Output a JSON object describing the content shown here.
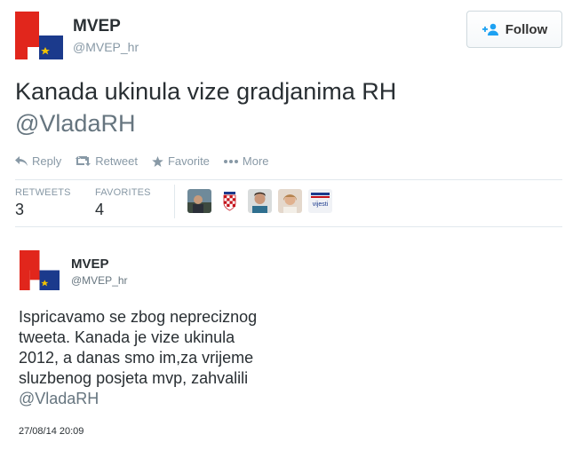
{
  "tweet1": {
    "name": "MVEP",
    "handle": "@MVEP_hr",
    "follow_label": "Follow",
    "text": "Kanada ukinula vize gradjanima RH",
    "mention": "@VladaRH",
    "actions": {
      "reply": "Reply",
      "retweet": "Retweet",
      "favorite": "Favorite",
      "more": "More"
    },
    "stats": {
      "retweets_label": "RETWEETS",
      "retweets_value": "3",
      "favorites_label": "FAVORITES",
      "favorites_value": "4"
    },
    "favorited_by_icons": [
      "user-photo-1",
      "croatia-crest-icon",
      "user-photo-2",
      "user-photo-3",
      "vijesti-logo"
    ],
    "vijesti_logo_text": "vijesti"
  },
  "tweet2": {
    "name": "MVEP",
    "handle": "@MVEP_hr",
    "text_lines": [
      "Ispricavamo se zbog nepreciznog",
      "tweeta. Kanada je vize ukinula",
      "2012, a danas smo im,za vrijeme",
      "sluzbenog posjeta mvp, zahvalili"
    ],
    "mention": "@VladaRH",
    "timestamp": "27/08/14 20:09"
  },
  "colors": {
    "logo_red": "#e1261c",
    "logo_blue": "#1b3a8c",
    "logo_gold": "#f2c400",
    "muted": "#8899a6",
    "text": "#292f33"
  }
}
